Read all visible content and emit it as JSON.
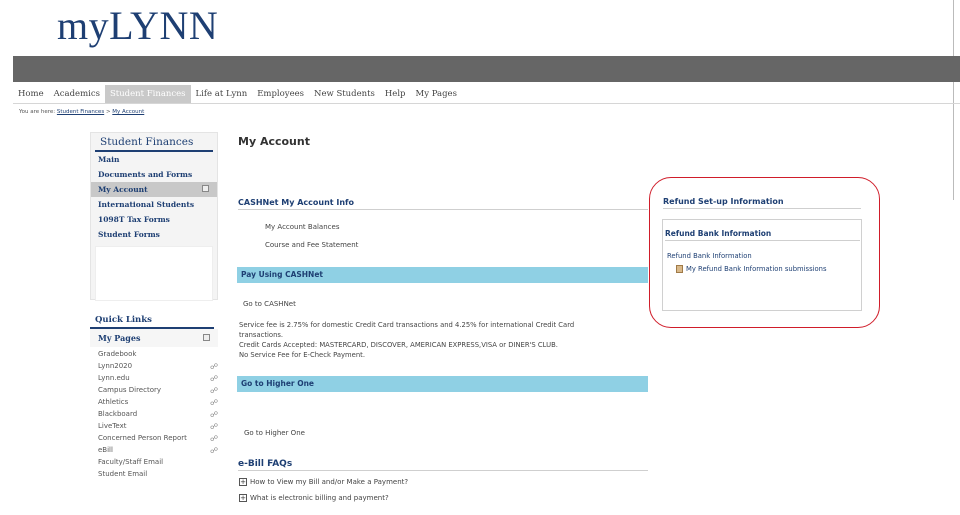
{
  "logo": {
    "prefix": "my",
    "brand": "LYNN"
  },
  "nav": [
    {
      "label": "Home",
      "active": false
    },
    {
      "label": "Academics",
      "active": false
    },
    {
      "label": "Student Finances",
      "active": true
    },
    {
      "label": "Life at Lynn",
      "active": false
    },
    {
      "label": "Employees",
      "active": false
    },
    {
      "label": "New Students",
      "active": false
    },
    {
      "label": "Help",
      "active": false
    },
    {
      "label": "My Pages",
      "active": false
    }
  ],
  "breadcrumb": {
    "prefix": "You are here:",
    "items": [
      "Student Finances",
      "My Account"
    ],
    "separator": ">"
  },
  "sidebar": {
    "title": "Student Finances",
    "items": [
      "Main",
      "Documents and Forms",
      "My Account",
      "International Students",
      "1098T Tax Forms",
      "Student Forms"
    ],
    "active_index": 2
  },
  "quick_links": {
    "title": "Quick Links",
    "my_pages": "My Pages",
    "items": [
      "Gradebook",
      "Lynn2020",
      "Lynn.edu",
      "Campus Directory",
      "Athletics",
      "Blackboard",
      "LiveText",
      "Concerned Person Report",
      "eBill",
      "Faculty/Staff Email",
      "Student Email"
    ],
    "link_icon_items": [
      1,
      2,
      3,
      4,
      5,
      6,
      7,
      8
    ]
  },
  "main": {
    "title": "My Account",
    "cashnet_title": "CASHNet My Account Info",
    "cashnet_links": [
      "My Account Balances",
      "Course and Fee Statement"
    ],
    "pay_bar": "Pay Using CASHNet",
    "go_cashnet": "Go to CASHNet",
    "service_text": [
      "Service fee is 2.75% for domestic Credit Card transactions and 4.25% for international Credit Card",
      "transactions.",
      "Credit Cards Accepted: MASTERCARD, DISCOVER, AMERICAN EXPRESS,VISA or DINER'S CLUB.",
      "No Service Fee for E-Check Payment."
    ],
    "higher_one_bar": "Go to Higher One",
    "go_higher_one": "Go to Higher One",
    "ebill_title": "e-Bill FAQs",
    "faqs": [
      "How to View my Bill and/or Make a Payment?",
      "What is electronic billing and payment?"
    ]
  },
  "refund": {
    "setup_title": "Refund Set-up Information",
    "bank_title": "Refund Bank Information",
    "bank_sub": "Refund Bank Information",
    "submission_link": "My Refund Bank Information submissions"
  }
}
